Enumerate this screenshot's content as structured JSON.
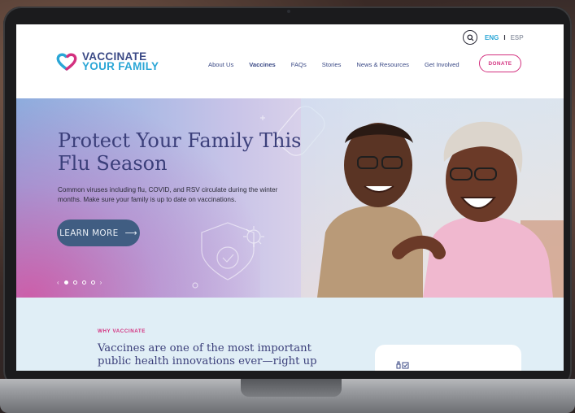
{
  "header": {
    "logo_line1": "VACCINATE",
    "logo_line2": "YOUR FAMILY",
    "lang_eng": "ENG",
    "lang_sep": "I",
    "lang_esp": "ESP",
    "nav": [
      "About Us",
      "Vaccines",
      "FAQs",
      "Stories",
      "News & Resources",
      "Get Involved"
    ],
    "active_nav": "Vaccines",
    "donate": "DONATE"
  },
  "hero": {
    "title": "Protect Your Family This Flu Season",
    "body": "Common viruses including flu, COVID, and RSV circulate during the winter months. Make sure your family is up to date on vaccinations.",
    "button": "LEARN MORE",
    "button_arrow": "⟶",
    "prev": "‹",
    "next": "›"
  },
  "why": {
    "eyebrow": "WHY VACCINATE",
    "heading": "Vaccines are one of the most important public health innovations ever—right up"
  },
  "colors": {
    "navy": "#3b4a86",
    "cyan": "#2aa6d6",
    "magenta": "#d3307f",
    "button": "#405d82"
  }
}
